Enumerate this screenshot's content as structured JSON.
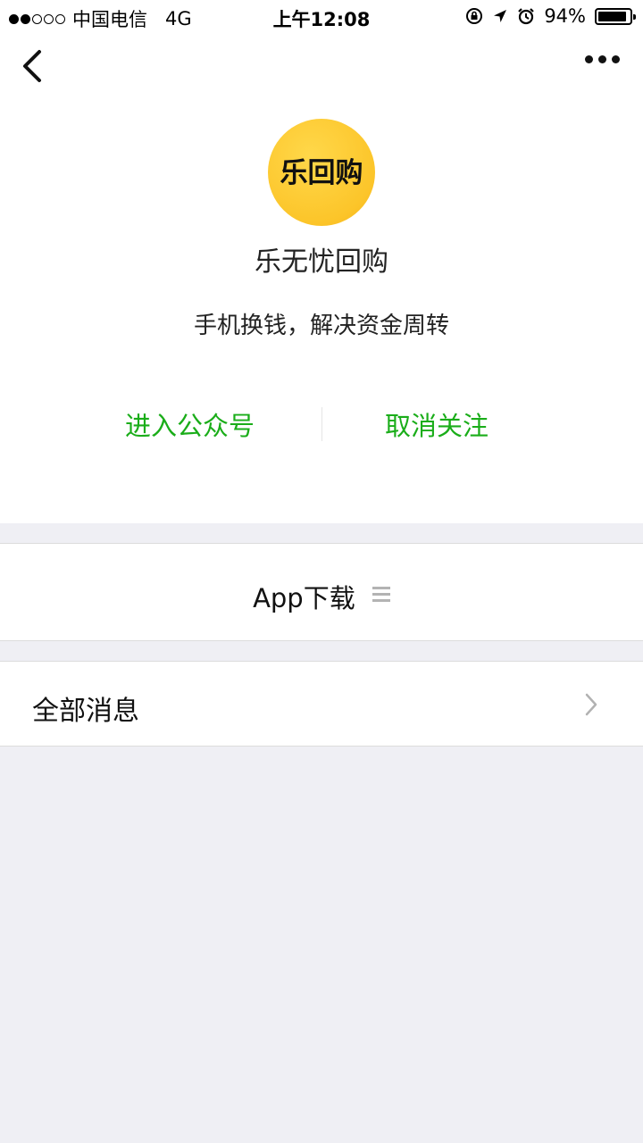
{
  "status_bar": {
    "carrier": "中国电信",
    "network": "4G",
    "time": "上午12:08",
    "battery": "94%",
    "battery_level": 0.94,
    "icons": [
      "rotation-lock-icon",
      "location-arrow-icon",
      "alarm-icon",
      "battery-icon"
    ]
  },
  "nav": {
    "back_icon": "chevron-left-icon",
    "more_icon": "more-dots-icon"
  },
  "profile": {
    "avatar_text": "乐回购",
    "name": "乐无忧回购",
    "description": "手机换钱，解决资金周转",
    "accent_color": "#1aad19",
    "avatar_color": "#fcc52a"
  },
  "actions": {
    "enter": "进入公众号",
    "unfollow": "取消关注"
  },
  "menu": {
    "item_label": "App下载",
    "item_icon": "menu-lines-icon"
  },
  "messages": {
    "label": "全部消息",
    "chevron_icon": "chevron-right-icon"
  }
}
